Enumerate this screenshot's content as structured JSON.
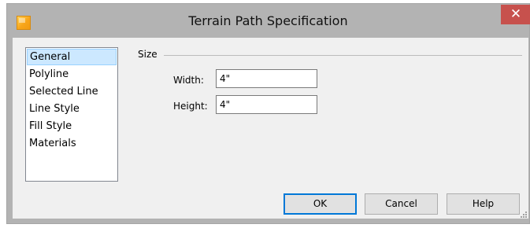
{
  "window": {
    "title": "Terrain Path Specification",
    "close_glyph": "✕"
  },
  "nav": {
    "items": [
      {
        "label": "General",
        "selected": true
      },
      {
        "label": "Polyline",
        "selected": false
      },
      {
        "label": "Selected Line",
        "selected": false
      },
      {
        "label": "Line Style",
        "selected": false
      },
      {
        "label": "Fill Style",
        "selected": false
      },
      {
        "label": "Materials",
        "selected": false
      }
    ]
  },
  "size_group": {
    "label": "Size",
    "width_label": "Width:",
    "width_value": "4\"",
    "height_label": "Height:",
    "height_value": "4\""
  },
  "buttons": {
    "ok": "OK",
    "cancel": "Cancel",
    "help": "Help"
  },
  "colors": {
    "title_bar": "#b3b3b3",
    "close_button": "#c7514d",
    "selection_fill": "#cce8ff",
    "selection_border": "#99d1ff",
    "default_button_border": "#0078d7"
  },
  "icons": {
    "app": "app-icon",
    "close": "close-icon",
    "grip": "resize-grip-icon"
  }
}
